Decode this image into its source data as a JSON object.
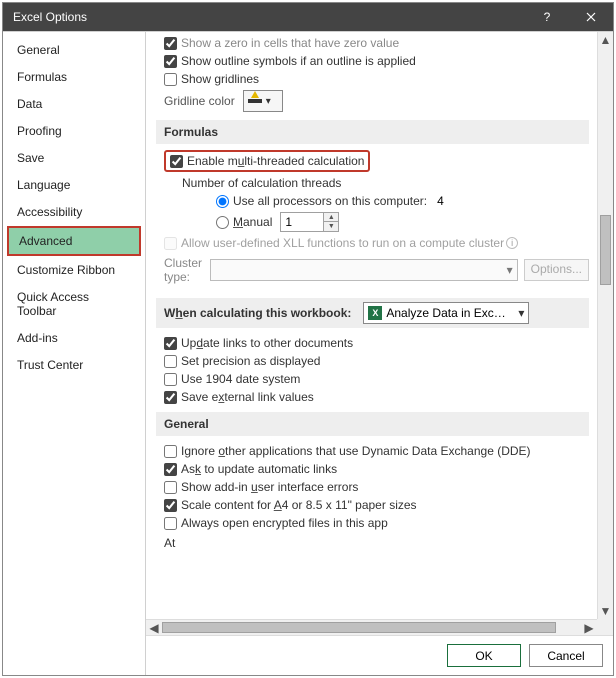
{
  "titlebar": {
    "title": "Excel Options"
  },
  "sidebar": {
    "items": [
      {
        "label": "General"
      },
      {
        "label": "Formulas"
      },
      {
        "label": "Data"
      },
      {
        "label": "Proofing"
      },
      {
        "label": "Save"
      },
      {
        "label": "Language"
      },
      {
        "label": "Accessibility"
      },
      {
        "label": "Advanced",
        "selected": true
      },
      {
        "label": "Customize Ribbon"
      },
      {
        "label": "Quick Access Toolbar"
      },
      {
        "label": "Add-ins"
      },
      {
        "label": "Trust Center"
      }
    ]
  },
  "content": {
    "clipped_top": "Show a zero in cells that have zero value",
    "show_outline": {
      "checked": true,
      "label": "Show outline symbols if an outline is applied"
    },
    "show_gridlines": {
      "checked": false,
      "label": "Show gridlines"
    },
    "gridline_color_label": "Gridline color",
    "formulas_head": "Formulas",
    "enable_mt": {
      "checked": true,
      "prefix": "Enable m",
      "u": "u",
      "suffix": "lti-threaded calculation"
    },
    "ncthreads_label": "Number of calculation threads",
    "use_all": {
      "checked": true,
      "label": "Use all processors on this computer:",
      "count": "4"
    },
    "manual": {
      "checked": false,
      "u": "M",
      "suffix": "anual",
      "value": "1"
    },
    "allow_xll": {
      "checked": false,
      "label": "Allow user-defined XLL functions to run on a compute cluster"
    },
    "cluster": {
      "label": "Cluster type:",
      "options_btn": "Options..."
    },
    "when_calc": {
      "prefix": "W",
      "u": "h",
      "suffix": "en calculating this workbook:",
      "wbname": "Analyze Data in Exc…"
    },
    "update_links": {
      "checked": true,
      "prefix": "Up",
      "u": "d",
      "suffix": "ate links to other documents"
    },
    "set_precision": {
      "checked": false,
      "label": "Set precision as displayed"
    },
    "use_1904": {
      "checked": false,
      "label": "Use 1904 date system"
    },
    "save_ext": {
      "checked": true,
      "prefix": "Save e",
      "u": "x",
      "suffix": "ternal link values"
    },
    "general_head": "General",
    "ignore_dde": {
      "checked": false,
      "prefix": "Ignore ",
      "u": "o",
      "suffix": "ther applications that use Dynamic Data Exchange (DDE)"
    },
    "ask_update": {
      "checked": true,
      "prefix": "As",
      "u": "k",
      "suffix": " to update automatic links"
    },
    "show_addin": {
      "checked": false,
      "prefix": "Show add-in ",
      "u": "u",
      "suffix": "ser interface errors"
    },
    "scale_a4": {
      "checked": true,
      "prefix": "Scale content for ",
      "u": "A",
      "suffix": "4 or 8.5 x 11\" paper sizes"
    },
    "always_open": {
      "checked": false,
      "label": "Always open encrypted files in this app"
    },
    "at_label": "At"
  },
  "buttons": {
    "ok": "OK",
    "cancel": "Cancel"
  }
}
